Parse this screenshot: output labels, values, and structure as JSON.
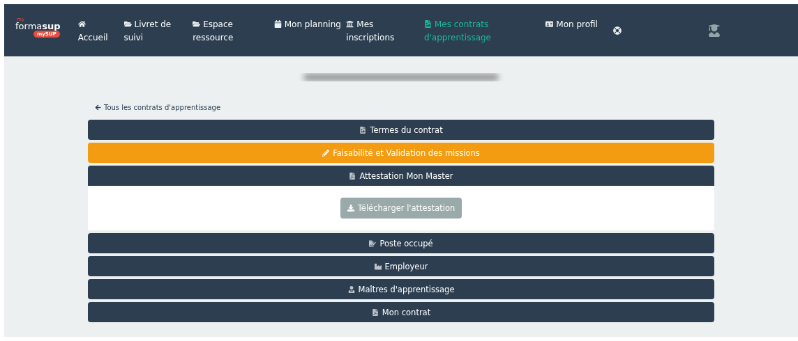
{
  "nav": {
    "logo": {
      "top": "my",
      "main": "forma",
      "bold": "sup",
      "badge": "mySUP"
    },
    "items": [
      {
        "label": "Accueil",
        "selected": false
      },
      {
        "label": "Livret de suivi",
        "selected": false
      },
      {
        "label": "Espace ressource",
        "selected": false
      },
      {
        "label": "Mon planning",
        "selected": false
      },
      {
        "label": "Mes inscriptions",
        "selected": false
      },
      {
        "label": "Mes contrats d'apprentissage",
        "selected": true
      },
      {
        "label": "Mon profil",
        "selected": false
      }
    ]
  },
  "back_link": "Tous les contrats d'apprentissage",
  "sections": [
    {
      "title": "Termes du contrat",
      "active": false,
      "expanded": false
    },
    {
      "title": "Faisabilité et Validation des missions",
      "active": true,
      "expanded": false
    },
    {
      "title": "Attestation Mon Master",
      "active": false,
      "expanded": true,
      "button": {
        "label": "Télécharger l'attestation",
        "disabled": true
      }
    },
    {
      "title": "Poste occupé",
      "active": false,
      "expanded": false
    },
    {
      "title": "Employeur",
      "active": false,
      "expanded": false
    },
    {
      "title": "Maîtres d'apprentissage",
      "active": false,
      "expanded": false
    },
    {
      "title": "Mon contrat",
      "active": false,
      "expanded": false
    }
  ]
}
